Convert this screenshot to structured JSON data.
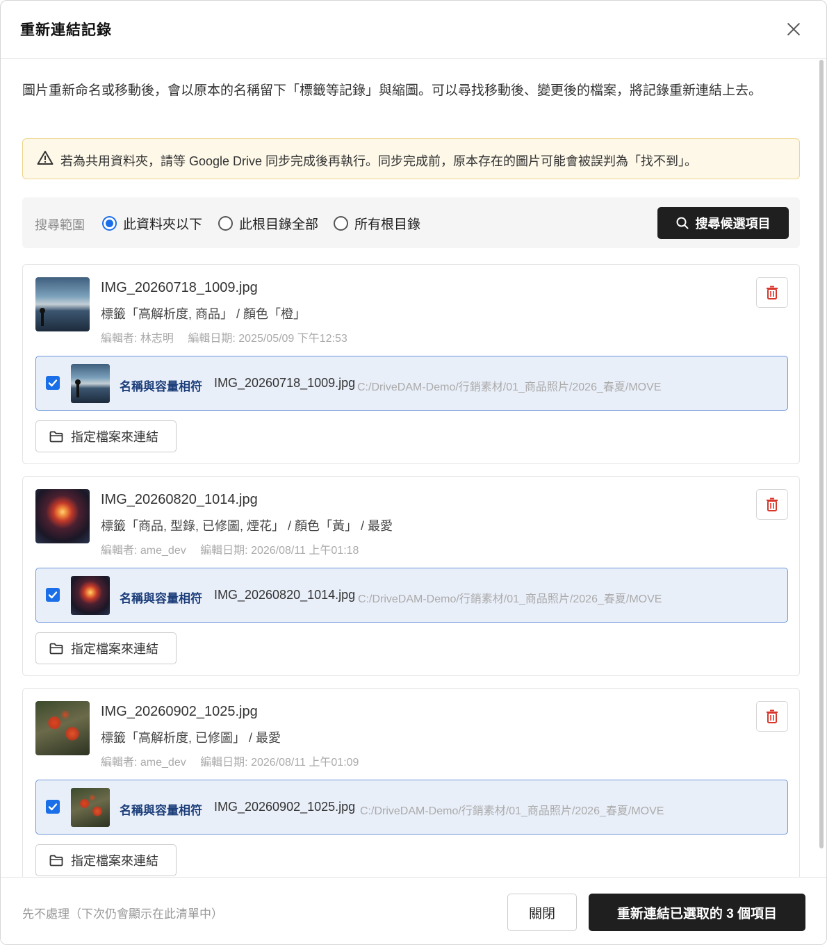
{
  "dialog": {
    "title": "重新連結記錄",
    "intro": "圖片重新命名或移動後，會以原本的名稱留下「標籤等記錄」與縮圖。可以尋找移動後、變更後的檔案，將記錄重新連結上去。",
    "warning": "若為共用資料夾，請等 Google Drive 同步完成後再執行。同步完成前，原本存在的圖片可能會被誤判為「找不到」。"
  },
  "search": {
    "scope_label": "搜尋範圍",
    "options": [
      "此資料夾以下",
      "此根目錄全部",
      "所有根目錄"
    ],
    "selected": "此資料夾以下",
    "button_label": "搜尋候選項目"
  },
  "records": [
    {
      "filename": "IMG_20260718_1009.jpg",
      "tags": "標籤「高解析度, 商品」 / 顏色「橙」",
      "editor": "編輯者: 林志明",
      "edit_date": "編輯日期: 2025/05/09 下午12:53",
      "thumb": "ocean-sunset-image",
      "match_label": "名稱與容量相符",
      "match_name": "IMG_20260718_1009.jpg",
      "match_path": "C:/DriveDAM-Demo/行銷素材/01_商品照片/2026_春夏/MOVE",
      "checked": true,
      "assign_label": "指定檔案來連結"
    },
    {
      "filename": "IMG_20260820_1014.jpg",
      "tags": "標籤「商品, 型錄, 已修圖, 煙花」 / 顏色「黃」 / 最愛",
      "editor": "編輯者: ame_dev",
      "edit_date": "編輯日期: 2026/08/11 上午01:18",
      "thumb": "fireworks-image",
      "match_label": "名稱與容量相符",
      "match_name": "IMG_20260820_1014.jpg",
      "match_path": "C:/DriveDAM-Demo/行銷素材/01_商品照片/2026_春夏/MOVE",
      "checked": true,
      "assign_label": "指定檔案來連結"
    },
    {
      "filename": "IMG_20260902_1025.jpg",
      "tags": "標籤「高解析度, 已修圖」 / 最愛",
      "editor": "編輯者: ame_dev",
      "edit_date": "編輯日期: 2026/08/11 上午01:09",
      "thumb": "flower-image",
      "match_label": "名稱與容量相符",
      "match_name": "IMG_20260902_1025.jpg",
      "match_path": "C:/DriveDAM-Demo/行銷素材/01_商品照片/2026_春夏/MOVE",
      "checked": true,
      "assign_label": "指定檔案來連結"
    }
  ],
  "footer": {
    "skip_label": "先不處理（下次仍會顯示在此清單中）",
    "close_label": "關閉",
    "confirm_label": "重新連結已選取的 3 個項目"
  },
  "colors": {
    "accent": "#1a6ee8",
    "primary_button": "#1f1f1f",
    "match_bg": "#e9eff9",
    "warning_bg": "#fdf8e8",
    "delete_icon": "#d9362b"
  }
}
